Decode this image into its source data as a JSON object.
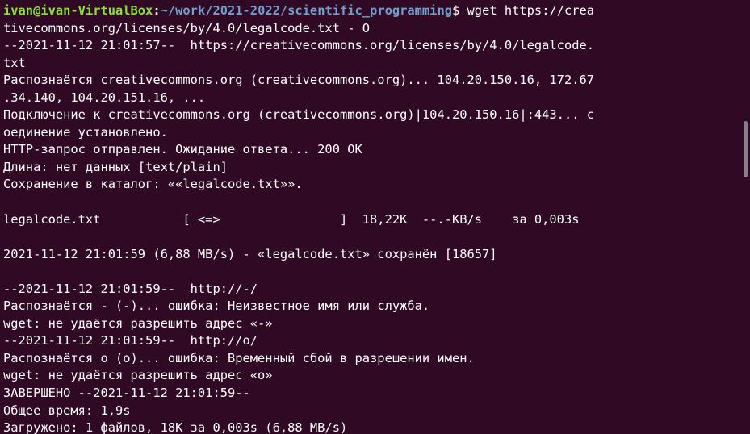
{
  "prompt": {
    "user_host": "ivan@ivan-VirtualBox",
    "separator": ":",
    "cwd": "~/work/2021-2022/scientific_programming",
    "symbol": "$ ",
    "command_start": "wget https://crea"
  },
  "output_lines": [
    "tivecommons.org/licenses/by/4.0/legalcode.txt - O",
    "--2021-11-12 21:01:57--  https://creativecommons.org/licenses/by/4.0/legalcode.",
    "txt",
    "Распознаётся creativecommons.org (creativecommons.org)... 104.20.150.16, 172.67",
    ".34.140, 104.20.151.16, ...",
    "Подключение к creativecommons.org (creativecommons.org)|104.20.150.16|:443... с",
    "оединение установлено.",
    "HTTP-запрос отправлен. Ожидание ответа... 200 OK",
    "Длина: нет данных [text/plain]",
    "Сохранение в каталог: ««legalcode.txt»».",
    "",
    "legalcode.txt           [ <=>                ]  18,22K  --.-KB/s    за 0,003s",
    "",
    "2021-11-12 21:01:59 (6,88 MB/s) - «legalcode.txt» сохранён [18657]",
    "",
    "--2021-11-12 21:01:59--  http://-/",
    "Распознаётся - (-)... ошибка: Неизвестное имя или служба.",
    "wget: не удаётся разрешить адрес «-»",
    "--2021-11-12 21:01:59--  http://o/",
    "Распознаётся o (o)... ошибка: Временный сбой в разрешении имен.",
    "wget: не удаётся разрешить адрес «o»",
    "ЗАВЕРШЕНО --2021-11-12 21:01:59--",
    "Общее время: 1,9s",
    "Загружено: 1 файлов, 18K за 0,003s (6,88 MB/s)"
  ],
  "colors": {
    "background": "#300a24",
    "text": "#ffffff",
    "user_host": "#8ae234",
    "cwd": "#729fcf",
    "scrollbar": "#8b7d89"
  }
}
